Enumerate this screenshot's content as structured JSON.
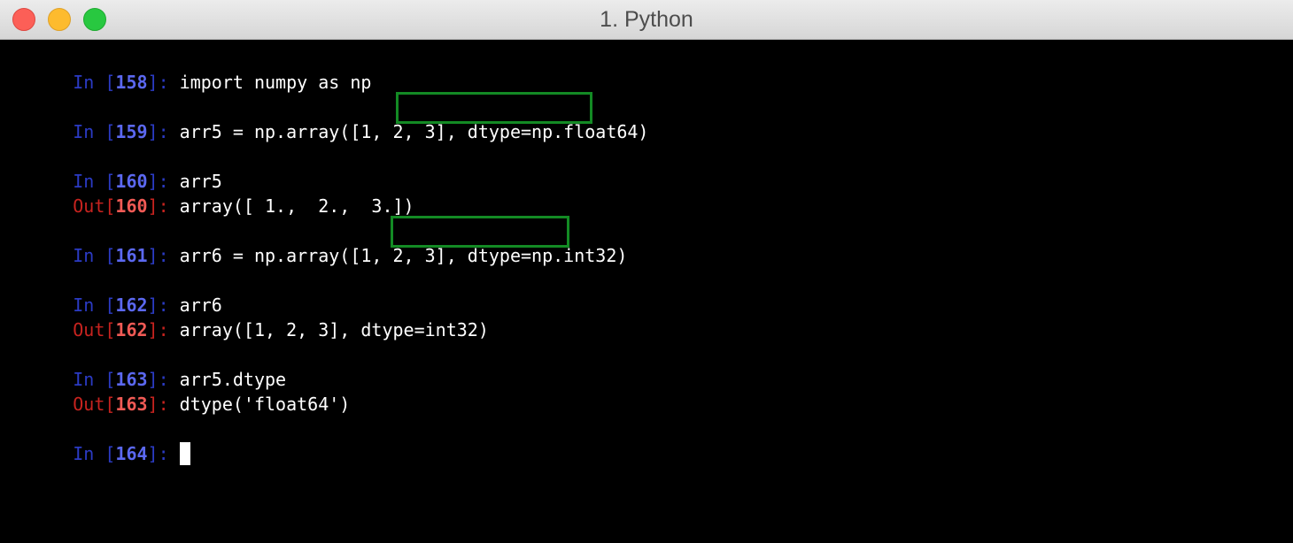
{
  "window": {
    "title": "1. Python"
  },
  "colors": {
    "background": "#000000",
    "prompt_in": "#5b68f0",
    "prompt_out": "#f05a55",
    "code": "#ffffff",
    "highlight_box": "#138a24"
  },
  "cells": [
    {
      "in_label": "In [",
      "in_num": "158",
      "in_close": "]: ",
      "code": "import numpy as np"
    },
    {
      "in_label": "In [",
      "in_num": "159",
      "in_close": "]: ",
      "code": "arr5 = np.array([1, 2, 3], dtype=np.float64)",
      "highlight": "dtype=np.float64)"
    },
    {
      "in_label": "In [",
      "in_num": "160",
      "in_close": "]: ",
      "code": "arr5",
      "out_label": "Out[",
      "out_num": "160",
      "out_close": "]: ",
      "output": "array([ 1.,  2.,  3.])"
    },
    {
      "in_label": "In [",
      "in_num": "161",
      "in_close": "]: ",
      "code": "arr6 = np.array([1, 2, 3], dtype=np.int32)",
      "highlight": "dtype=np.int32)"
    },
    {
      "in_label": "In [",
      "in_num": "162",
      "in_close": "]: ",
      "code": "arr6",
      "out_label": "Out[",
      "out_num": "162",
      "out_close": "]: ",
      "output": "array([1, 2, 3], dtype=int32)"
    },
    {
      "in_label": "In [",
      "in_num": "163",
      "in_close": "]: ",
      "code": "arr5.dtype",
      "out_label": "Out[",
      "out_num": "163",
      "out_close": "]: ",
      "output": "dtype('float64')"
    },
    {
      "in_label": "In [",
      "in_num": "164",
      "in_close": "]: ",
      "code": ""
    }
  ]
}
